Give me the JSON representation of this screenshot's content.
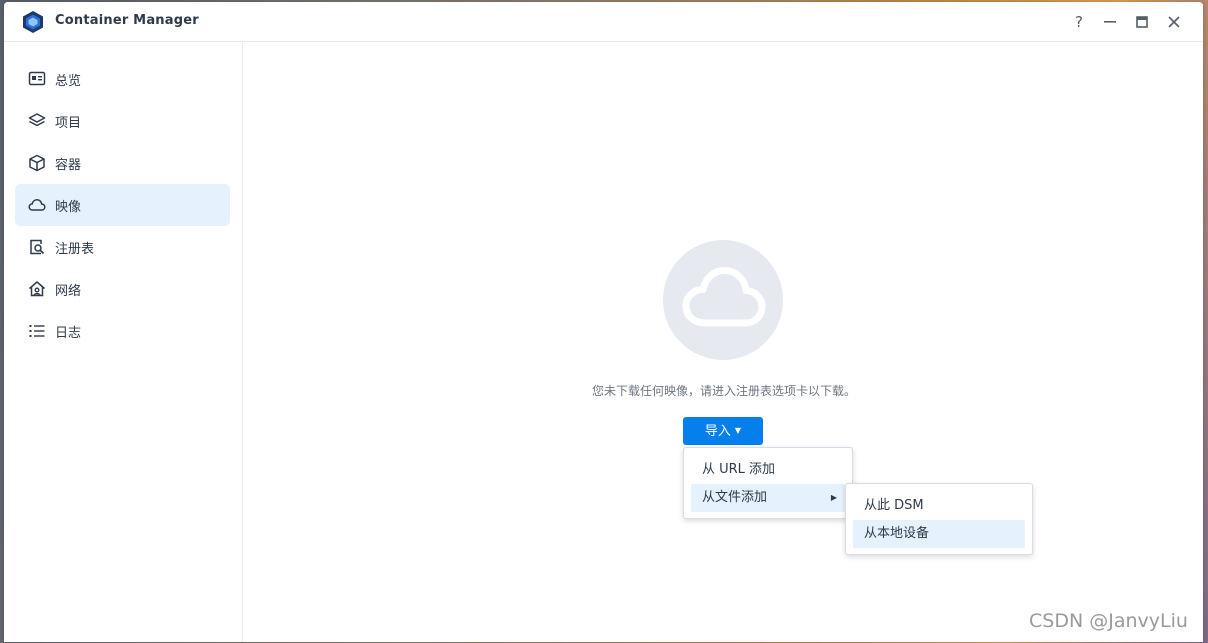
{
  "app": {
    "title": "Container Manager"
  },
  "window_controls": {
    "help": "?",
    "minimize": "—",
    "maximize": "▭",
    "close": "✕"
  },
  "sidebar": {
    "items": [
      {
        "label": "总览",
        "icon": "overview-icon"
      },
      {
        "label": "项目",
        "icon": "layers-icon"
      },
      {
        "label": "容器",
        "icon": "cube-icon"
      },
      {
        "label": "映像",
        "icon": "cloud-icon",
        "active": true
      },
      {
        "label": "注册表",
        "icon": "registry-search-icon"
      },
      {
        "label": "网络",
        "icon": "network-home-icon"
      },
      {
        "label": "日志",
        "icon": "list-icon"
      }
    ]
  },
  "main": {
    "empty_message": "您未下载任何映像，请进入注册表选项卡以下载。",
    "import_button": "导入",
    "import_menu": {
      "items": [
        "从 URL 添加",
        "从文件添加"
      ]
    },
    "file_submenu": {
      "items": [
        "从此 DSM",
        "从本地设备"
      ]
    }
  },
  "watermark": "CSDN @JanvyLiu",
  "colors": {
    "accent": "#057feb",
    "active_bg": "#e5f1fc",
    "empty_circle": "#e6e9ef"
  }
}
